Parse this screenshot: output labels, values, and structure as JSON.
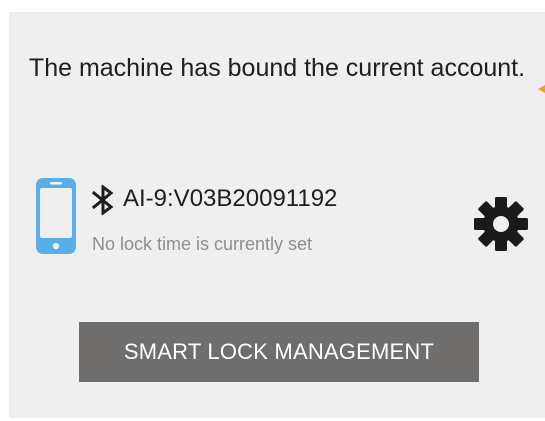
{
  "message": "The machine has bound the current account.",
  "device": {
    "name": "AI-9:V03B20091192",
    "lock_status": "No lock time is currently set",
    "phone_icon": "smartphone-icon",
    "connection_icon": "bluetooth-icon",
    "settings_icon": "gear-icon"
  },
  "actions": {
    "smart_lock_label": "SMART LOCK MANAGEMENT"
  },
  "colors": {
    "panel_background": "#efefef",
    "phone_icon": "#5aaee6",
    "button_background": "#6f6e6c",
    "button_text": "#ffffff",
    "accent": "#f0a030"
  }
}
